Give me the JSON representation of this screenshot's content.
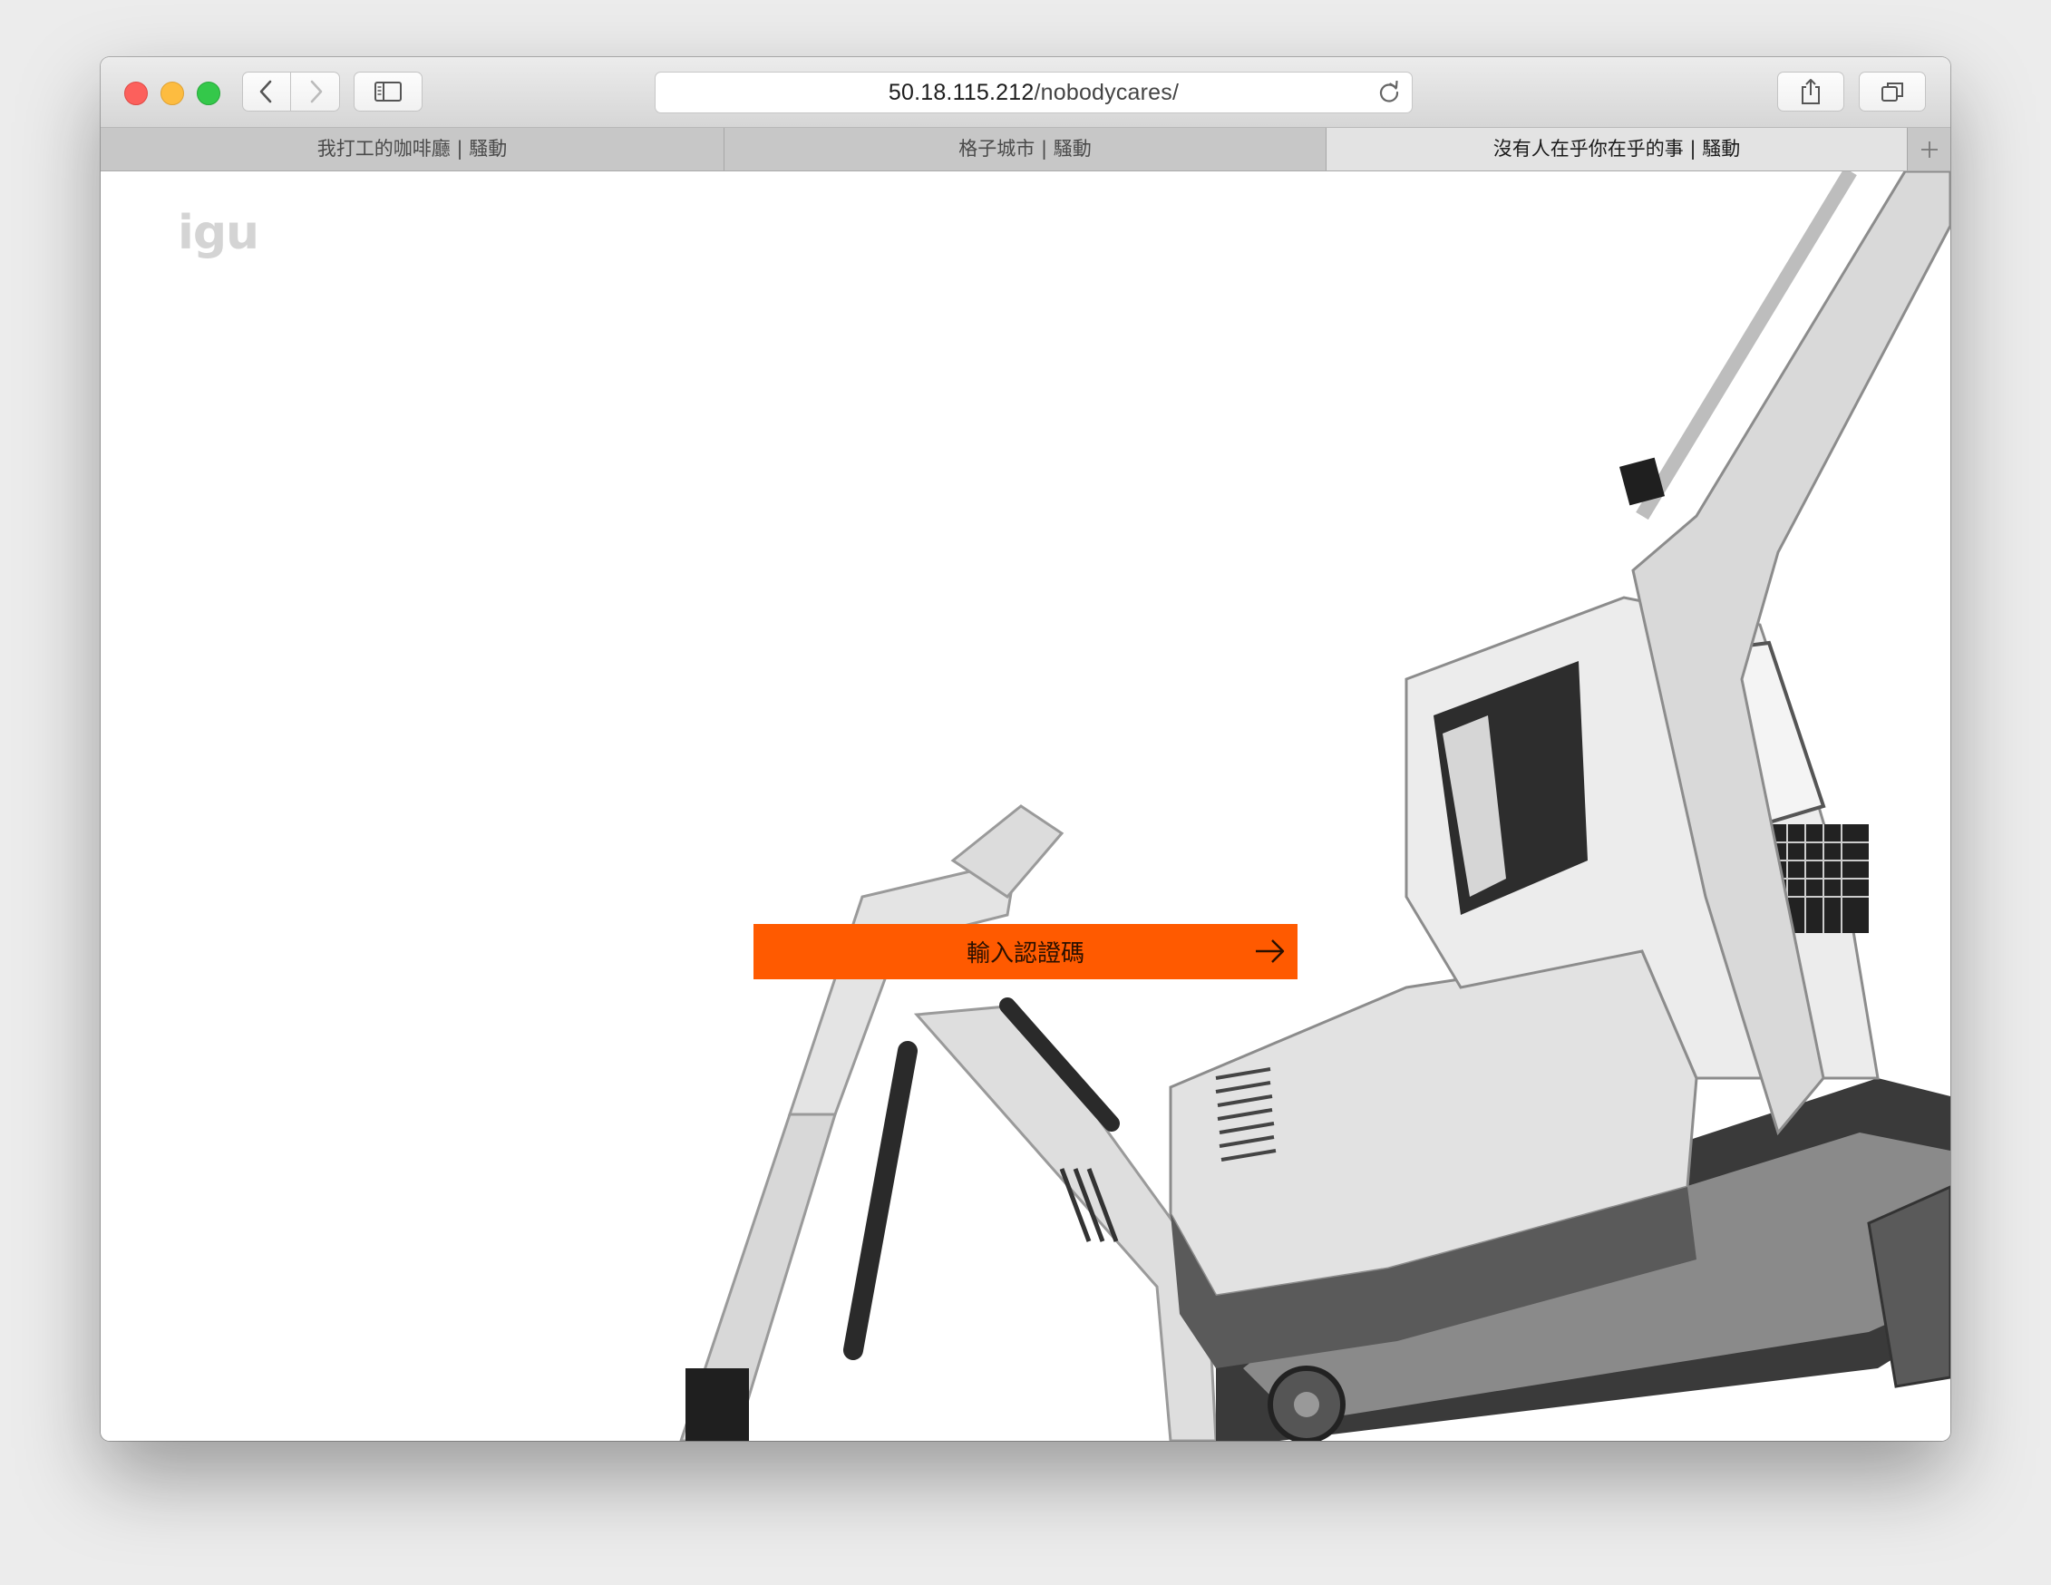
{
  "browser": {
    "address": {
      "host": "50.18.115.212",
      "path": "/nobodycares/"
    },
    "tabs": [
      {
        "label": "我打工的咖啡廳 | 騷動",
        "active": false
      },
      {
        "label": "格子城市 | 騷動",
        "active": false
      },
      {
        "label": "沒有人在乎你在乎的事 | 騷動",
        "active": true
      }
    ],
    "icons": {
      "back": "chevron-left-icon",
      "forward": "chevron-right-icon",
      "sidebar": "sidebar-icon",
      "reload": "reload-icon",
      "share": "share-icon",
      "tabs": "tab-overview-icon",
      "new_tab": "plus-icon"
    }
  },
  "page": {
    "logo": "igu",
    "cta": {
      "label": "輸入認證碼",
      "color": "#ff5a00",
      "icon": "arrow-right-icon"
    },
    "hero_image": "excavator-illustration"
  }
}
